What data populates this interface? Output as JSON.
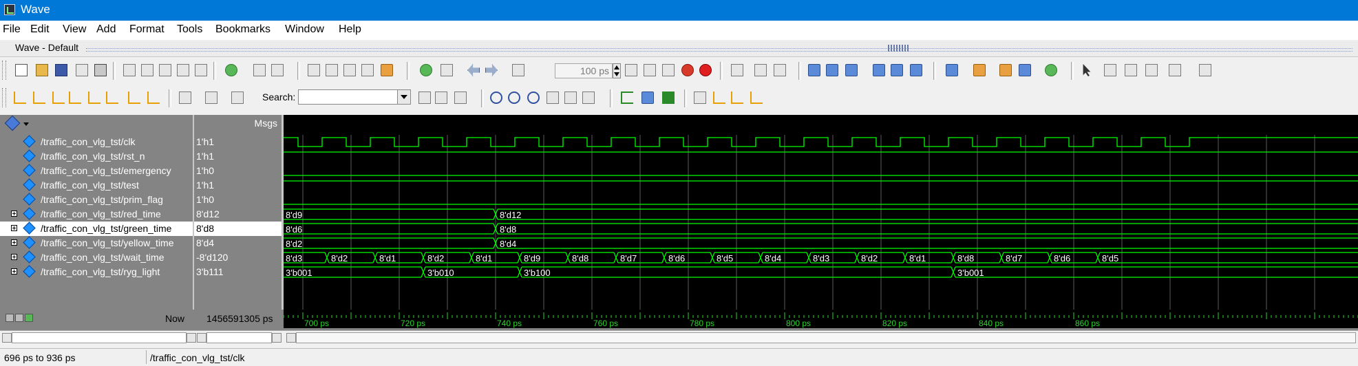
{
  "window": {
    "title": "Wave"
  },
  "menu": [
    "File",
    "Edit",
    "View",
    "Add",
    "Format",
    "Tools",
    "Bookmarks",
    "Window",
    "Help"
  ],
  "pane": {
    "title": "Wave - Default"
  },
  "toolbar": {
    "search_label": "Search:",
    "search_value": "",
    "run_length": "100 ps"
  },
  "signals": {
    "msgs_header": "Msgs",
    "rows": [
      {
        "name": "/traffic_con_vlg_tst/clk",
        "value": "1'h1",
        "expandable": false,
        "selected": false
      },
      {
        "name": "/traffic_con_vlg_tst/rst_n",
        "value": "1'h1",
        "expandable": false,
        "selected": false
      },
      {
        "name": "/traffic_con_vlg_tst/emergency",
        "value": "1'h0",
        "expandable": false,
        "selected": false
      },
      {
        "name": "/traffic_con_vlg_tst/test",
        "value": "1'h1",
        "expandable": false,
        "selected": false
      },
      {
        "name": "/traffic_con_vlg_tst/prim_flag",
        "value": "1'h0",
        "expandable": false,
        "selected": false
      },
      {
        "name": "/traffic_con_vlg_tst/red_time",
        "value": "8'd12",
        "expandable": true,
        "selected": false
      },
      {
        "name": "/traffic_con_vlg_tst/green_time",
        "value": "8'd8",
        "expandable": true,
        "selected": true
      },
      {
        "name": "/traffic_con_vlg_tst/yellow_time",
        "value": "8'd4",
        "expandable": true,
        "selected": false
      },
      {
        "name": "/traffic_con_vlg_tst/wait_time",
        "value": "-8'd120",
        "expandable": true,
        "selected": false
      },
      {
        "name": "/traffic_con_vlg_tst/ryg_light",
        "value": "3'b111",
        "expandable": true,
        "selected": false
      }
    ]
  },
  "waves": {
    "time_start_ps": 696,
    "time_end_ps": 936,
    "grid_period_ps": 10,
    "clk_rise_ps": [
      704,
      714,
      724,
      734,
      744,
      754,
      764,
      774,
      784,
      794,
      804,
      814,
      824,
      834,
      844,
      854,
      864,
      874,
      884
    ],
    "clk_fall_ps": [
      699,
      709,
      719,
      729,
      739,
      749,
      759,
      769,
      779,
      789,
      799,
      809,
      819,
      829,
      839,
      849,
      859,
      869,
      879
    ],
    "bus": {
      "red_time": [
        {
          "t": 696,
          "v": "8'd9"
        },
        {
          "t": 740,
          "v": "8'd12"
        }
      ],
      "green_time": [
        {
          "t": 696,
          "v": "8'd6"
        },
        {
          "t": 740,
          "v": "8'd8"
        }
      ],
      "yellow_time": [
        {
          "t": 696,
          "v": "8'd2"
        },
        {
          "t": 740,
          "v": "8'd4"
        }
      ],
      "wait_time": [
        {
          "t": 696,
          "v": "8'd3"
        },
        {
          "t": 705,
          "v": "8'd2"
        },
        {
          "t": 715,
          "v": "8'd1"
        },
        {
          "t": 725,
          "v": "8'd2"
        },
        {
          "t": 735,
          "v": "8'd1"
        },
        {
          "t": 745,
          "v": "8'd9"
        },
        {
          "t": 755,
          "v": "8'd8"
        },
        {
          "t": 765,
          "v": "8'd7"
        },
        {
          "t": 775,
          "v": "8'd6"
        },
        {
          "t": 785,
          "v": "8'd5"
        },
        {
          "t": 795,
          "v": "8'd4"
        },
        {
          "t": 805,
          "v": "8'd3"
        },
        {
          "t": 815,
          "v": "8'd2"
        },
        {
          "t": 825,
          "v": "8'd1"
        },
        {
          "t": 835,
          "v": "8'd8"
        },
        {
          "t": 845,
          "v": "8'd7"
        },
        {
          "t": 855,
          "v": "8'd6"
        },
        {
          "t": 865,
          "v": "8'd5"
        }
      ],
      "ryg_light": [
        {
          "t": 696,
          "v": "3'b001"
        },
        {
          "t": 725,
          "v": "3'b010"
        },
        {
          "t": 745,
          "v": "3'b100"
        },
        {
          "t": 835,
          "v": "3'b001"
        }
      ]
    }
  },
  "cursor": {
    "now_label": "Now",
    "now_value": "1456591305 ps"
  },
  "time_axis": {
    "labels": [
      {
        "t": 700,
        "text": "700 ps"
      },
      {
        "t": 720,
        "text": "720 ps"
      },
      {
        "t": 740,
        "text": "740 ps"
      },
      {
        "t": 760,
        "text": "760 ps"
      },
      {
        "t": 780,
        "text": "780 ps"
      },
      {
        "t": 800,
        "text": "800 ps"
      },
      {
        "t": 820,
        "text": "820 ps"
      },
      {
        "t": 840,
        "text": "840 ps"
      },
      {
        "t": 860,
        "text": "860 ps"
      }
    ]
  },
  "status": {
    "range": "696 ps to 936 ps",
    "signal": "/traffic_con_vlg_tst/clk"
  },
  "colors": {
    "wave": "#00ff00",
    "grid": "#5a5a5a",
    "selected_bg": "#ffffff",
    "panel_bg": "#848484",
    "title_bar": "#0078d7"
  }
}
